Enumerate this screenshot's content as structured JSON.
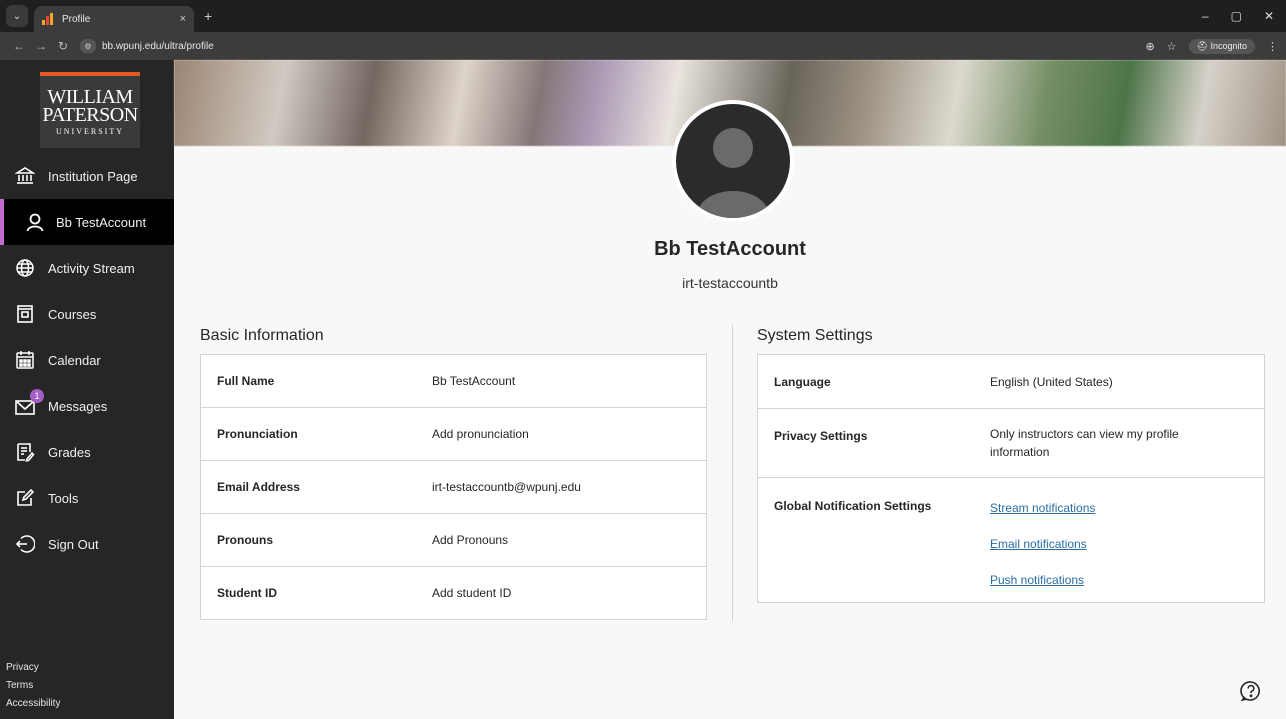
{
  "browser": {
    "tab_title": "Profile",
    "tab_close": "×",
    "new_tab": "+",
    "url": "bb.wpunj.edu/ultra/profile",
    "incognito_label": "Incognito",
    "win_min": "–",
    "win_max": "▢",
    "win_close": "✕"
  },
  "logo": {
    "line1": "WILLIAM",
    "line2": "PATERSON",
    "line3": "UNIVERSITY",
    "accent_color": "#e15a22"
  },
  "sidebar": {
    "items": [
      {
        "label": "Institution Page",
        "icon": "institution-icon"
      },
      {
        "label": "Bb TestAccount",
        "icon": "user-icon",
        "active": true
      },
      {
        "label": "Activity Stream",
        "icon": "globe-icon"
      },
      {
        "label": "Courses",
        "icon": "courses-icon"
      },
      {
        "label": "Calendar",
        "icon": "calendar-icon"
      },
      {
        "label": "Messages",
        "icon": "envelope-icon",
        "badge": "1"
      },
      {
        "label": "Grades",
        "icon": "grades-icon"
      },
      {
        "label": "Tools",
        "icon": "tools-icon"
      },
      {
        "label": "Sign Out",
        "icon": "sign-out-icon"
      }
    ],
    "footer": [
      "Privacy",
      "Terms",
      "Accessibility"
    ],
    "active_color": "#c06ccc"
  },
  "profile": {
    "name": "Bb TestAccount",
    "username": "irt-testaccountb"
  },
  "basic_info": {
    "title": "Basic Information",
    "rows": [
      {
        "label": "Full Name",
        "value": "Bb TestAccount"
      },
      {
        "label": "Pronunciation",
        "value": "Add pronunciation"
      },
      {
        "label": "Email Address",
        "value": "irt-testaccountb@wpunj.edu"
      },
      {
        "label": "Pronouns",
        "value": "Add Pronouns"
      },
      {
        "label": "Student ID",
        "value": "Add student ID"
      }
    ]
  },
  "system_settings": {
    "title": "System Settings",
    "language_label": "Language",
    "language_value": "English (United States)",
    "privacy_label": "Privacy Settings",
    "privacy_value": "Only instructors can view my profile information",
    "notif_label": "Global Notification Settings",
    "notif_links": [
      "Stream notifications",
      "Email notifications",
      "Push notifications"
    ],
    "link_color": "#2b6ea3"
  }
}
